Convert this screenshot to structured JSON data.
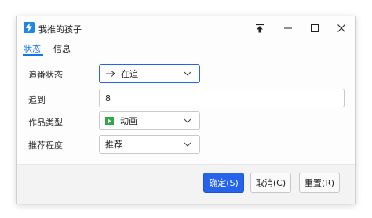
{
  "window": {
    "title": "我推的孩子"
  },
  "tabs": [
    {
      "label": "状态"
    },
    {
      "label": "信息"
    }
  ],
  "form": {
    "status": {
      "label": "追番状态",
      "value": "在追"
    },
    "progress": {
      "label": "追到",
      "value": "8"
    },
    "type": {
      "label": "作品类型",
      "value": "动画"
    },
    "rating": {
      "label": "推荐程度",
      "value": "推荐"
    }
  },
  "buttons": {
    "ok": "确定(S)",
    "cancel": "取消(C)",
    "reset": "重置(R)"
  },
  "colors": {
    "accent": "#2563eb",
    "tab_active": "#1a73e8",
    "type_icon": "#2fa84a"
  }
}
